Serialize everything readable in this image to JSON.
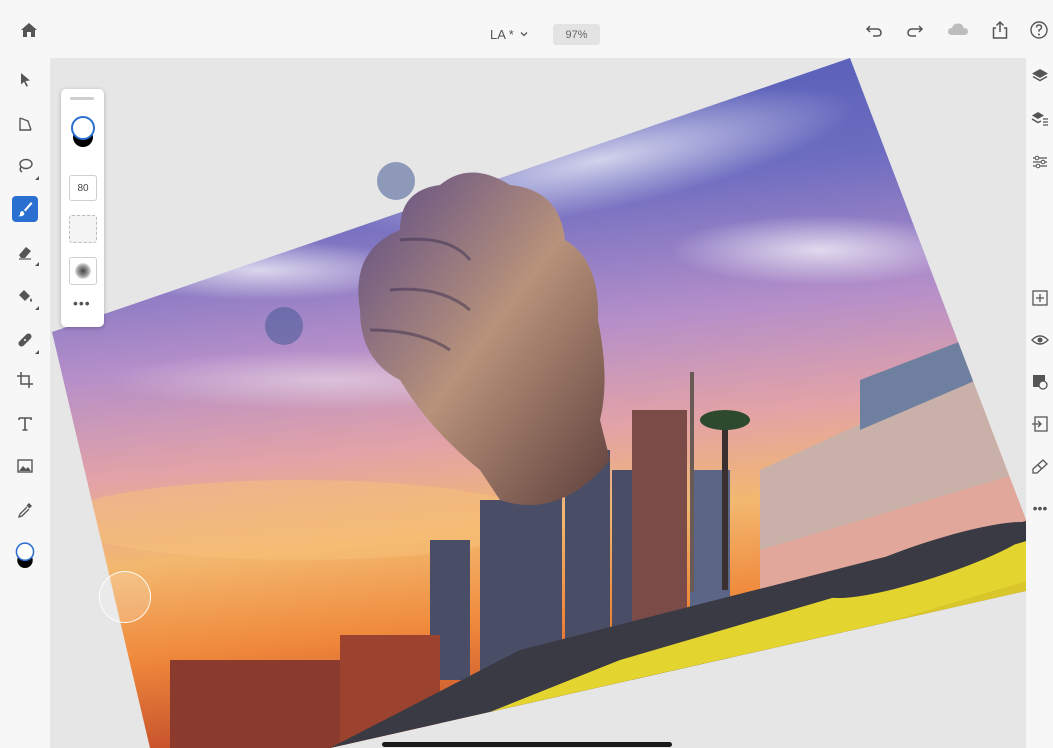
{
  "header": {
    "document_title": "LA *",
    "zoom": "97%"
  },
  "icons": {
    "home": "home-icon",
    "undo": "undo-icon",
    "redo": "redo-icon",
    "cloud": "cloud-icon",
    "share": "share-icon",
    "help": "help-icon"
  },
  "left_tools": [
    "select",
    "transform",
    "lasso",
    "brush",
    "eraser",
    "fill",
    "healing",
    "crop",
    "type",
    "place-image",
    "eyedropper",
    "color"
  ],
  "brush_panel": {
    "size": "80"
  },
  "right_tools": [
    "layers",
    "layer-properties",
    "adjustments",
    "add-layer",
    "visibility",
    "mask",
    "import",
    "fx",
    "more"
  ],
  "colors": {
    "accent": "#2b6fd1",
    "foreground": "#ffffff",
    "background": "#000000"
  }
}
